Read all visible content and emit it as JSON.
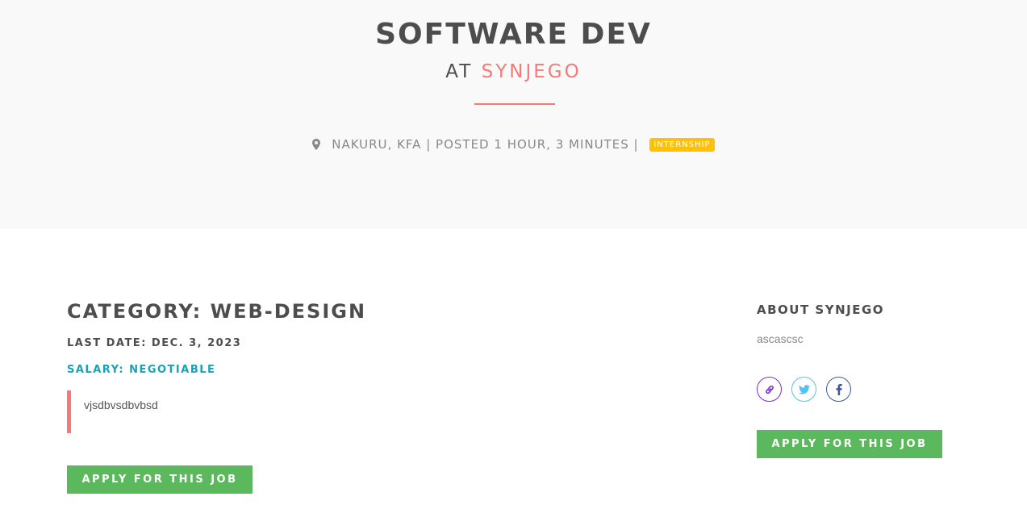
{
  "header": {
    "job_title": "SOFTWARE DEV",
    "at_label": "AT",
    "company_name": "SYNJEGO",
    "location": "NAKURU, KFA",
    "separator": "|",
    "posted": "POSTED 1 HOUR, 3 MINUTES",
    "job_type": "INTERNSHIP"
  },
  "main": {
    "category": "CATEGORY: WEB-DESIGN",
    "last_date": "LAST DATE: DEC. 3, 2023",
    "salary": "SALARY: NEGOTIABLE",
    "description": "vjsdbvsdbvbsd",
    "apply_label": "APPLY FOR THIS JOB"
  },
  "sidebar": {
    "about_title": "ABOUT SYNJEGO",
    "about_text": "ascascsc",
    "social_icons": [
      "link-icon",
      "twitter-icon",
      "facebook-icon"
    ],
    "apply_label": "APPLY FOR THIS JOB"
  },
  "colors": {
    "accent": "#f47a7a",
    "badge": "#ffc107",
    "salary": "#17a2b8",
    "button": "#5cb85c"
  }
}
